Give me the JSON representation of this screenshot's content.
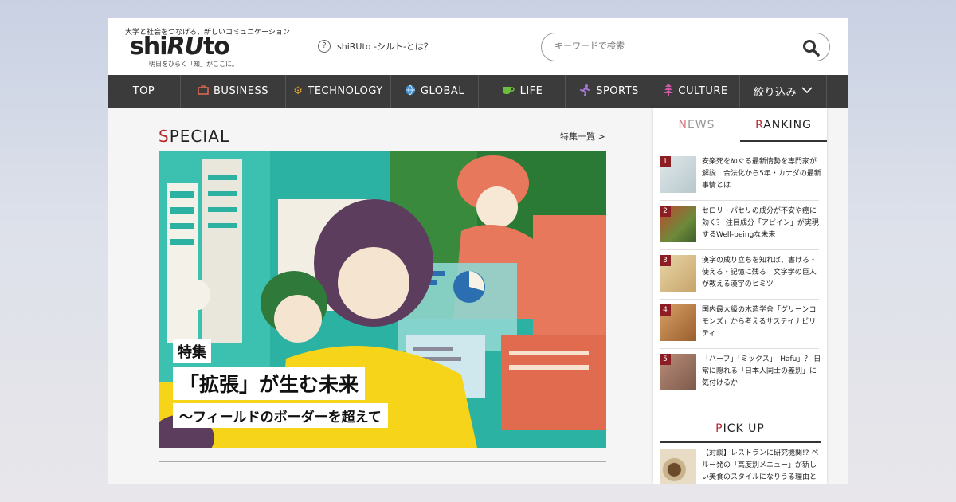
{
  "header": {
    "tagline": "大学と社会をつなげる、新しいコミュニケーション",
    "logo_part1": "shi",
    "logo_part2": "RU",
    "logo_part3": "to",
    "logo_sub": "明日をひらく「知」がここに。",
    "about_label": "shiRUto -シルト-とは？",
    "search_placeholder": "キーワードで検索"
  },
  "nav": {
    "items": [
      {
        "label": "TOP",
        "icon": "none"
      },
      {
        "label": "BUSINESS",
        "icon": "briefcase-icon"
      },
      {
        "label": "TECHNOLOGY",
        "icon": "gear-icon"
      },
      {
        "label": "GLOBAL",
        "icon": "globe-icon"
      },
      {
        "label": "LIFE",
        "icon": "cup-icon"
      },
      {
        "label": "SPORTS",
        "icon": "runner-icon"
      },
      {
        "label": "CULTURE",
        "icon": "pagoda-icon"
      },
      {
        "label": "絞り込み",
        "icon": "chevron-down-icon"
      }
    ]
  },
  "special": {
    "heading_first": "S",
    "heading_rest": "PECIAL",
    "all_link": "特集一覧 >",
    "label": "特集",
    "title": "「拡張」が生む未来",
    "subtitle": "〜フィールドのボーダーを超えて"
  },
  "sidebar": {
    "tab_news_first": "N",
    "tab_news_rest": "EWS",
    "tab_ranking_first": "R",
    "tab_ranking_rest": "ANKING",
    "ranking": [
      {
        "rank": "1",
        "text": "安楽死をめぐる最新情勢を専門家が解説　合法化から5年・カナダの最新事情とは"
      },
      {
        "rank": "2",
        "text": "セロリ・パセリの成分が不安や癌に効く？ 注目成分「アピイン」が実現するWell-beingな未来"
      },
      {
        "rank": "3",
        "text": "漢字の成り立ちを知れば、書ける・使える・記憶に残る　文字学の巨人が教える漢字のヒミツ"
      },
      {
        "rank": "4",
        "text": "国内最大級の木造学舎「グリーンコモンズ」から考えるサステイナビリティ"
      },
      {
        "rank": "5",
        "text": "「ハーフ」「ミックス」「Hafu」？ 日常に隠れる「日本人同士の差別」に気付けるか"
      }
    ],
    "pickup_first": "P",
    "pickup_rest": "ICK UP",
    "pickup_text": "【対談】レストランに研究機関!? ペルー発の「高度別メニュー」が新しい美食のスタイルになりうる理由とは？"
  },
  "colors": {
    "accent": "#b3282d",
    "nav_bg": "#3b3b3b",
    "rank_badge": "#8c1d22"
  }
}
